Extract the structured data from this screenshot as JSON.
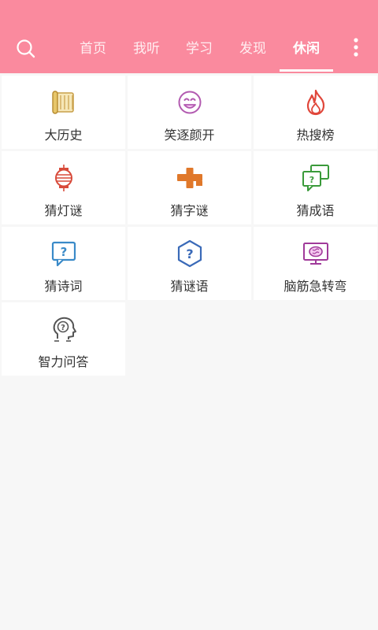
{
  "header": {
    "search_icon": "search-icon",
    "tabs": [
      {
        "label": "首页"
      },
      {
        "label": "我听"
      },
      {
        "label": "学习"
      },
      {
        "label": "发现"
      },
      {
        "label": "休闲",
        "active": true
      }
    ],
    "more_icon": "more-vertical-icon",
    "colors": {
      "background": "#fa8a9e",
      "text": "#ffffff"
    }
  },
  "grid": {
    "items": [
      {
        "label": "大历史",
        "icon": "scroll-icon",
        "color": "#d4a84a"
      },
      {
        "label": "笑逐颜开",
        "icon": "smiley-icon",
        "color": "#b25ab0"
      },
      {
        "label": "热搜榜",
        "icon": "flame-icon",
        "color": "#e0463a"
      },
      {
        "label": "猜灯谜",
        "icon": "lantern-icon",
        "color": "#d84a3a"
      },
      {
        "label": "猜字谜",
        "icon": "cross-puzzle-icon",
        "color": "#e0782a"
      },
      {
        "label": "猜成语",
        "icon": "chat-question-icon",
        "color": "#3a9a3a"
      },
      {
        "label": "猜诗词",
        "icon": "speech-question-icon",
        "color": "#3a8ac8"
      },
      {
        "label": "猜谜语",
        "icon": "hexagon-question-icon",
        "color": "#3a6ab8"
      },
      {
        "label": "脑筋急转弯",
        "icon": "brain-monitor-icon",
        "color": "#a03a9a"
      },
      {
        "label": "智力问答",
        "icon": "head-question-icon",
        "color": "#555555"
      }
    ]
  }
}
